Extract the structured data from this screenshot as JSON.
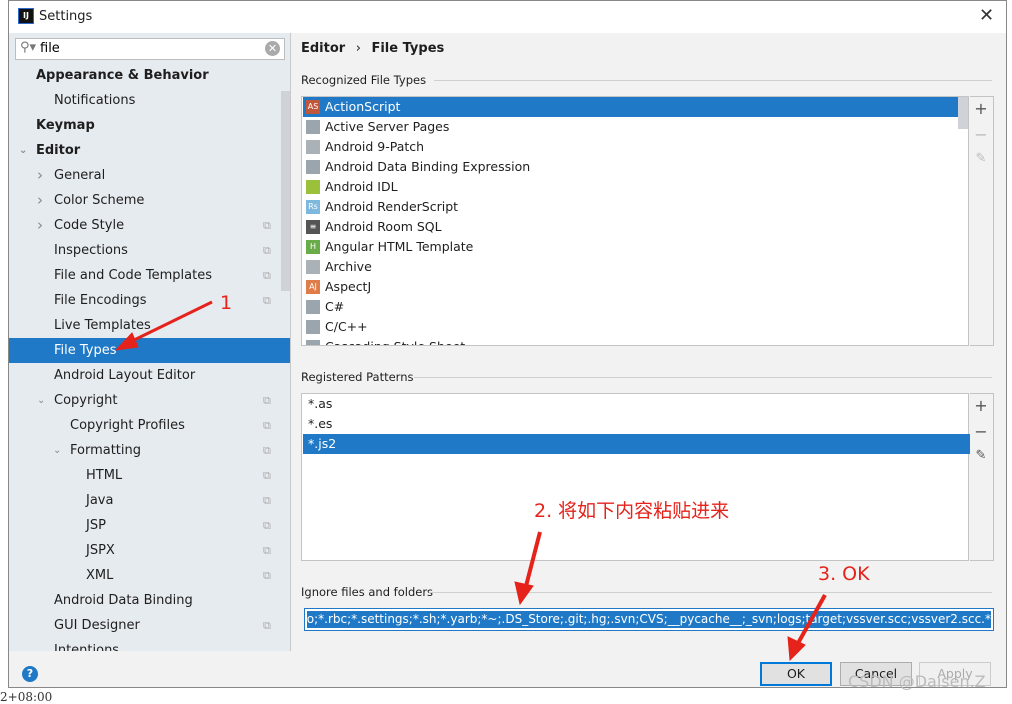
{
  "window": {
    "title": "Settings",
    "close": "✕",
    "app_icon": "IJ"
  },
  "background": {
    "fragment": "2+08:00"
  },
  "search": {
    "value": "file"
  },
  "tree": [
    {
      "label": "Appearance & Behavior",
      "bold": true,
      "indent": 1
    },
    {
      "label": "Notifications",
      "indent": 2
    },
    {
      "label": "Keymap",
      "bold": true,
      "indent": 1
    },
    {
      "label": "Editor",
      "bold": true,
      "indent": 1,
      "arrow": "down"
    },
    {
      "label": "General",
      "indent": 2,
      "arrow": "right"
    },
    {
      "label": "Color Scheme",
      "indent": 2,
      "arrow": "right"
    },
    {
      "label": "Code Style",
      "indent": 2,
      "arrow": "right",
      "copy": true
    },
    {
      "label": "Inspections",
      "indent": 2,
      "copy": true
    },
    {
      "label": "File and Code Templates",
      "indent": 2,
      "copy": true
    },
    {
      "label": "File Encodings",
      "indent": 2,
      "copy": true
    },
    {
      "label": "Live Templates",
      "indent": 2
    },
    {
      "label": "File Types",
      "indent": 2,
      "selected": true
    },
    {
      "label": "Android Layout Editor",
      "indent": 2
    },
    {
      "label": "Copyright",
      "indent": 2,
      "arrow": "down",
      "copy": true
    },
    {
      "label": "Copyright Profiles",
      "indent": 3,
      "copy": true
    },
    {
      "label": "Formatting",
      "indent": 3,
      "arrow": "down",
      "copy": true
    },
    {
      "label": "HTML",
      "indent": 4,
      "copy": true
    },
    {
      "label": "Java",
      "indent": 4,
      "copy": true
    },
    {
      "label": "JSP",
      "indent": 4,
      "copy": true
    },
    {
      "label": "JSPX",
      "indent": 4,
      "copy": true
    },
    {
      "label": "XML",
      "indent": 4,
      "copy": true
    },
    {
      "label": "Android Data Binding",
      "indent": 2
    },
    {
      "label": "GUI Designer",
      "indent": 2,
      "copy": true
    },
    {
      "label": "Intentions",
      "indent": 2
    }
  ],
  "breadcrumb": {
    "parent": "Editor",
    "sep": "›",
    "current": "File Types"
  },
  "recognized": {
    "label": "Recognized File Types",
    "items": [
      {
        "label": "ActionScript",
        "icon": "AS",
        "color": "#c0573a",
        "selected": true
      },
      {
        "label": "Active Server Pages",
        "icon": "",
        "color": "#9aa5ad"
      },
      {
        "label": "Android 9-Patch",
        "icon": "",
        "color": "#aab1b7"
      },
      {
        "label": "Android Data Binding Expression",
        "icon": "",
        "color": "#9aa5ad"
      },
      {
        "label": "Android IDL",
        "icon": "",
        "color": "#9bc03a"
      },
      {
        "label": "Android RenderScript",
        "icon": "Rs",
        "color": "#7fb8de"
      },
      {
        "label": "Android Room SQL",
        "icon": "≡",
        "color": "#555555"
      },
      {
        "label": "Angular HTML Template",
        "icon": "H",
        "color": "#6aab4a"
      },
      {
        "label": "Archive",
        "icon": "",
        "color": "#aab1b7"
      },
      {
        "label": "AspectJ",
        "icon": "AJ",
        "color": "#e07c4a"
      },
      {
        "label": "C#",
        "icon": "",
        "color": "#9aa5ad"
      },
      {
        "label": "C/C++",
        "icon": "",
        "color": "#9aa5ad"
      },
      {
        "label": "Cascading Style Sheet",
        "icon": "",
        "color": "#9aa5ad"
      }
    ]
  },
  "patterns": {
    "label": "Registered Patterns",
    "items": [
      {
        "label": "*.as"
      },
      {
        "label": "*.es"
      },
      {
        "label": "*.js2",
        "selected": true
      }
    ]
  },
  "toolbar": {
    "add": "+",
    "remove": "−",
    "edit": "✎"
  },
  "ignore": {
    "label": "Ignore files and folders",
    "value": "*.hprof;*.pyc;*.pyo;*.rbc;*.settings;*.sh;*.yarb;*~;.DS_Store;.git;.hg;.svn;CVS;__pycache__;_svn;logs;target;vssver.scc;vssver2.scc;"
  },
  "buttons": {
    "ok": "OK",
    "cancel": "Cancel",
    "apply": "Apply",
    "help": "?"
  },
  "annotations": {
    "one": "1",
    "two": "2. 将如下内容粘贴进来",
    "three": "3. OK",
    "color": "#e5231b"
  },
  "watermark": "CSDN @Daisen.Z"
}
